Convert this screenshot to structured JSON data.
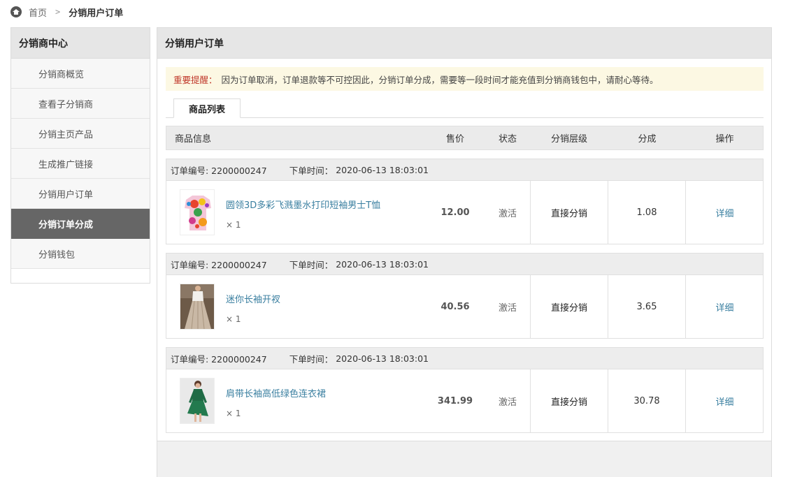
{
  "breadcrumb": {
    "home": "首页",
    "separator": ">",
    "current": "分销用户订单"
  },
  "sidebar": {
    "title": "分销商中心",
    "items": [
      {
        "label": "分销商概览",
        "active": false
      },
      {
        "label": "查看子分销商",
        "active": false
      },
      {
        "label": "分销主页产品",
        "active": false
      },
      {
        "label": "生成推广链接",
        "active": false
      },
      {
        "label": "分销用户订单",
        "active": false
      },
      {
        "label": "分销订单分成",
        "active": true
      },
      {
        "label": "分销钱包",
        "active": false
      }
    ]
  },
  "main": {
    "title": "分销用户订单",
    "notice": {
      "label": "重要提醒：",
      "text": "因为订单取消，订单退款等不可控因此，分销订单分成，需要等一段时间才能充值到分销商钱包中，请耐心等待。"
    },
    "tab": "商品列表",
    "columns": {
      "info": "商品信息",
      "price": "售价",
      "status": "状态",
      "level": "分销层级",
      "share": "分成",
      "action": "操作"
    },
    "orders": [
      {
        "order_label": "订单编号: 2200000247",
        "time_label": "下单时间：",
        "time": "2020-06-13 18:03:01",
        "product": "圆领3D多彩飞溅墨水打印短袖男士T恤",
        "qty": "× 1",
        "price": "12.00",
        "status": "激活",
        "level": "直接分销",
        "share": "1.08",
        "action": "详细",
        "thumb_icon": "tshirt-image"
      },
      {
        "order_label": "订单编号: 2200000247",
        "time_label": "下单时间：",
        "time": "2020-06-13 18:03:01",
        "product": "迷你长袖开衩",
        "qty": "× 1",
        "price": "40.56",
        "status": "激活",
        "level": "直接分销",
        "share": "3.65",
        "action": "详细",
        "thumb_icon": "skirt-image"
      },
      {
        "order_label": "订单编号: 2200000247",
        "time_label": "下单时间：",
        "time": "2020-06-13 18:03:01",
        "product": "肩带长袖高低绿色连衣裙",
        "qty": "× 1",
        "price": "341.99",
        "status": "激活",
        "level": "直接分销",
        "share": "30.78",
        "action": "详细",
        "thumb_icon": "dress-image"
      }
    ]
  },
  "colors": {
    "sidebar_active_bg": "#666666",
    "link": "#3a7fa0",
    "notice_bg": "#fcf8e3",
    "notice_label": "#c0392b"
  }
}
